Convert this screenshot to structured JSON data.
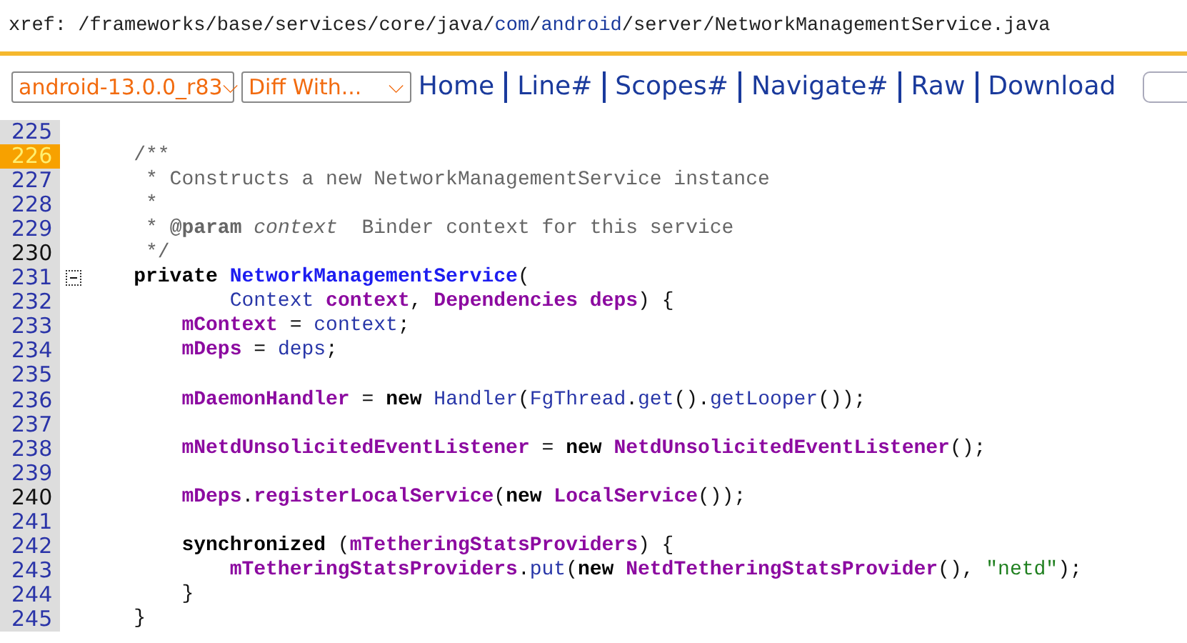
{
  "header": {
    "prefix": "xref:",
    "path": [
      {
        "text": "/frameworks/base/services/core/java/",
        "link": false
      },
      {
        "text": "com",
        "link": true
      },
      {
        "text": "/",
        "link": false
      },
      {
        "text": "android",
        "link": true
      },
      {
        "text": "/server/NetworkManagementService.java",
        "link": false
      }
    ]
  },
  "toolbar": {
    "branch": {
      "value": "android-13.0.0_r83",
      "caret": "⌵"
    },
    "diff": {
      "value": "Diff With...",
      "caret": "⌵"
    },
    "links": [
      "Home",
      "Line#",
      "Scopes#",
      "Navigate#",
      "Raw",
      "Download"
    ],
    "search_field": true
  },
  "lines": [
    {
      "number": "225",
      "selected": false,
      "dark": false,
      "foldable": false
    },
    {
      "number": "226",
      "selected": true,
      "dark": false,
      "foldable": false,
      "tokens": [
        {
          "kind": "comment",
          "text": "    /**"
        }
      ]
    },
    {
      "number": "227",
      "selected": false,
      "dark": false,
      "foldable": false,
      "tokens": [
        {
          "kind": "comment",
          "text": "     * Constructs a new NetworkManagementService instance"
        }
      ]
    },
    {
      "number": "228",
      "selected": false,
      "dark": false,
      "foldable": false,
      "tokens": [
        {
          "kind": "comment",
          "text": "     *"
        }
      ]
    },
    {
      "number": "229",
      "selected": false,
      "dark": false,
      "foldable": false,
      "tokens": [
        {
          "kind": "comment",
          "text": "     * "
        },
        {
          "kind": "tag",
          "text": "@param"
        },
        {
          "kind": "italic",
          "text": " context"
        },
        {
          "kind": "comment",
          "text": "  Binder context for this service"
        }
      ]
    },
    {
      "number": "230",
      "selected": false,
      "dark": true,
      "foldable": false,
      "tokens": [
        {
          "kind": "comment",
          "text": "     */"
        }
      ]
    },
    {
      "number": "231",
      "selected": false,
      "dark": false,
      "foldable": true,
      "tokens": [
        {
          "kind": "keyword",
          "text": "    private"
        },
        {
          "kind": "decl",
          "text": " NetworkManagementService"
        },
        {
          "kind": "plain",
          "text": "("
        }
      ]
    },
    {
      "number": "232",
      "selected": false,
      "dark": false,
      "foldable": false,
      "tokens": [
        {
          "kind": "ident",
          "text": "            Context"
        },
        {
          "kind": "field",
          "text": " context"
        },
        {
          "kind": "plain",
          "text": ", "
        },
        {
          "kind": "field",
          "text": "Dependencies"
        },
        {
          "kind": "field",
          "text": " deps"
        },
        {
          "kind": "plain",
          "text": ") {"
        }
      ]
    },
    {
      "number": "233",
      "selected": false,
      "dark": false,
      "foldable": false,
      "tokens": [
        {
          "kind": "field",
          "text": "        mContext"
        },
        {
          "kind": "plain",
          "text": " = "
        },
        {
          "kind": "ident",
          "text": "context"
        },
        {
          "kind": "plain",
          "text": ";"
        }
      ]
    },
    {
      "number": "234",
      "selected": false,
      "dark": false,
      "foldable": false,
      "tokens": [
        {
          "kind": "field",
          "text": "        mDeps"
        },
        {
          "kind": "plain",
          "text": " = "
        },
        {
          "kind": "ident",
          "text": "deps"
        },
        {
          "kind": "plain",
          "text": ";"
        }
      ]
    },
    {
      "number": "235",
      "selected": false,
      "dark": false,
      "foldable": false
    },
    {
      "number": "236",
      "selected": false,
      "dark": false,
      "foldable": false,
      "tokens": [
        {
          "kind": "field",
          "text": "        mDaemonHandler"
        },
        {
          "kind": "plain",
          "text": " = "
        },
        {
          "kind": "keyword",
          "text": "new"
        },
        {
          "kind": "ident",
          "text": " Handler"
        },
        {
          "kind": "plain",
          "text": "("
        },
        {
          "kind": "ident",
          "text": "FgThread"
        },
        {
          "kind": "plain",
          "text": "."
        },
        {
          "kind": "ident",
          "text": "get"
        },
        {
          "kind": "plain",
          "text": "()."
        },
        {
          "kind": "ident",
          "text": "getLooper"
        },
        {
          "kind": "plain",
          "text": "());"
        }
      ]
    },
    {
      "number": "237",
      "selected": false,
      "dark": false,
      "foldable": false
    },
    {
      "number": "238",
      "selected": false,
      "dark": false,
      "foldable": false,
      "tokens": [
        {
          "kind": "field",
          "text": "        mNetdUnsolicitedEventListener"
        },
        {
          "kind": "plain",
          "text": " = "
        },
        {
          "kind": "keyword",
          "text": "new"
        },
        {
          "kind": "field",
          "text": " NetdUnsolicitedEventListener"
        },
        {
          "kind": "plain",
          "text": "();"
        }
      ]
    },
    {
      "number": "239",
      "selected": false,
      "dark": false,
      "foldable": false
    },
    {
      "number": "240",
      "selected": false,
      "dark": true,
      "foldable": false,
      "tokens": [
        {
          "kind": "field",
          "text": "        mDeps"
        },
        {
          "kind": "plain",
          "text": "."
        },
        {
          "kind": "field",
          "text": "registerLocalService"
        },
        {
          "kind": "plain",
          "text": "("
        },
        {
          "kind": "keyword",
          "text": "new"
        },
        {
          "kind": "field",
          "text": " LocalService"
        },
        {
          "kind": "plain",
          "text": "());"
        }
      ]
    },
    {
      "number": "241",
      "selected": false,
      "dark": false,
      "foldable": false
    },
    {
      "number": "242",
      "selected": false,
      "dark": false,
      "foldable": false,
      "tokens": [
        {
          "kind": "keyword",
          "text": "        synchronized"
        },
        {
          "kind": "plain",
          "text": " ("
        },
        {
          "kind": "field",
          "text": "mTetheringStatsProviders"
        },
        {
          "kind": "plain",
          "text": ") {"
        }
      ]
    },
    {
      "number": "243",
      "selected": false,
      "dark": false,
      "foldable": false,
      "tokens": [
        {
          "kind": "field",
          "text": "            mTetheringStatsProviders"
        },
        {
          "kind": "plain",
          "text": "."
        },
        {
          "kind": "ident",
          "text": "put"
        },
        {
          "kind": "plain",
          "text": "("
        },
        {
          "kind": "keyword",
          "text": "new"
        },
        {
          "kind": "field",
          "text": " NetdTetheringStatsProvider"
        },
        {
          "kind": "plain",
          "text": "(), "
        },
        {
          "kind": "string",
          "text": "\"netd\""
        },
        {
          "kind": "plain",
          "text": ");"
        }
      ]
    },
    {
      "number": "244",
      "selected": false,
      "dark": false,
      "foldable": false,
      "tokens": [
        {
          "kind": "plain",
          "text": "        }"
        }
      ]
    },
    {
      "number": "245",
      "selected": false,
      "dark": false,
      "foldable": false,
      "tokens": [
        {
          "kind": "plain",
          "text": "    }"
        }
      ]
    }
  ]
}
